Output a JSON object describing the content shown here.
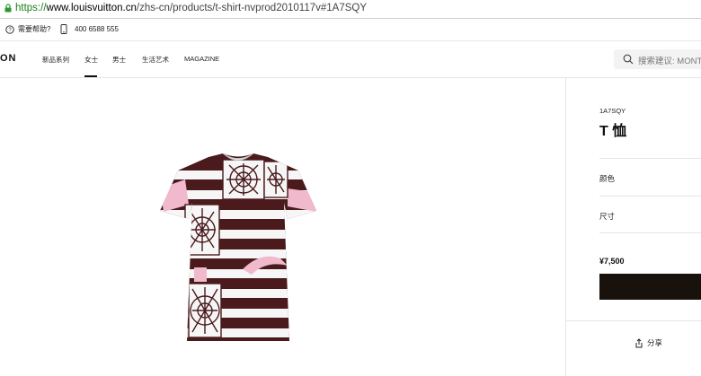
{
  "browser": {
    "url_scheme": "https://",
    "url_host": "www.louisvuitton.cn",
    "url_path": "/zhs-cn/products/t-shirt-nvprod2010117v#1A7SQY"
  },
  "utility_bar": {
    "help_label": "需要帮助?",
    "phone_number": "400 6588 555"
  },
  "header": {
    "logo_text": "ON",
    "nav": [
      "新品系列",
      "女士",
      "男士",
      "生活艺术",
      "MAGAZINE"
    ],
    "active_nav": "女士",
    "search_placeholder": "搜索建议: MONT"
  },
  "product": {
    "sku": "1A7SQY",
    "title": "T 恤",
    "color_label": "颜色",
    "size_label": "尺寸",
    "price": "¥7,500",
    "share_label": "分享",
    "image_icon": "tshirt-product-image",
    "colors": {
      "maroon": "#4a1a1d",
      "pink": "#f1b9cc",
      "white": "#f6f6f6",
      "button": "#19110b"
    }
  }
}
